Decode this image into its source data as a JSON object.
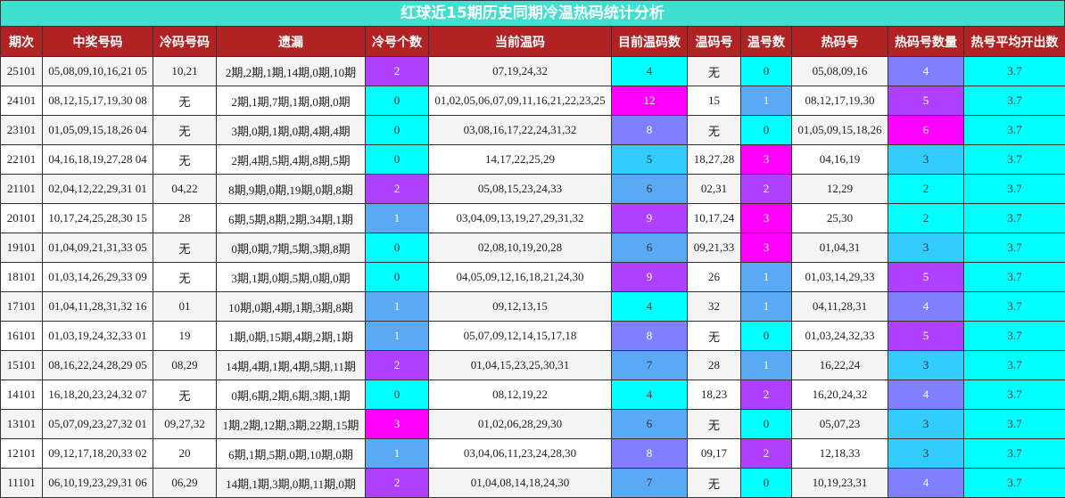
{
  "title": "红球近15期历史同期冷温热码统计分析",
  "headers": [
    "期次",
    "中奖号码",
    "冷码号码",
    "遗漏",
    "冷号个数",
    "当前温码",
    "目前温码数",
    "温码号",
    "温号数",
    "热码号",
    "热码号数量",
    "热号平均开出数"
  ],
  "colors": {
    "title_bg": "#40e0d0",
    "header_bg": "#b22222",
    "count_cyan": "#00ffff",
    "count_blue": "#5aa9f5",
    "count_lightblue": "#33ccff",
    "count_periwinkle": "#8080ff",
    "count_purple": "#b040ff",
    "count_magenta": "#ff00ff",
    "avg_bg": "#00ffff"
  },
  "rows": [
    {
      "period": "25101",
      "numbers": "05,08,09,10,16,21 05",
      "cold": "10,21",
      "missing": "2期,2期,1期,14期,0期,10期",
      "cold_count": "2",
      "warm_current": "07,19,24,32",
      "warm_current_count": "4",
      "warm": "无",
      "warm_count": "0",
      "hot": "05,08,09,16",
      "hot_count": "4",
      "avg": "3.7"
    },
    {
      "period": "24101",
      "numbers": "08,12,15,17,19,30 08",
      "cold": "无",
      "missing": "2期,1期,7期,1期,0期,0期",
      "cold_count": "0",
      "warm_current": "01,02,05,06,07,09,11,16,21,22,23,25",
      "warm_current_count": "12",
      "warm": "15",
      "warm_count": "1",
      "hot": "08,12,17,19,30",
      "hot_count": "5",
      "avg": "3.7"
    },
    {
      "period": "23101",
      "numbers": "01,05,09,15,18,26 04",
      "cold": "无",
      "missing": "3期,0期,1期,0期,4期,4期",
      "cold_count": "0",
      "warm_current": "03,08,16,17,22,24,31,32",
      "warm_current_count": "8",
      "warm": "无",
      "warm_count": "0",
      "hot": "01,05,09,15,18,26",
      "hot_count": "6",
      "avg": "3.7"
    },
    {
      "period": "22101",
      "numbers": "04,16,18,19,27,28 04",
      "cold": "无",
      "missing": "2期,4期,5期,4期,8期,5期",
      "cold_count": "0",
      "warm_current": "14,17,22,25,29",
      "warm_current_count": "5",
      "warm": "18,27,28",
      "warm_count": "3",
      "hot": "04,16,19",
      "hot_count": "3",
      "avg": "3.7"
    },
    {
      "period": "21101",
      "numbers": "02,04,12,22,29,31 01",
      "cold": "04,22",
      "missing": "8期,9期,0期,19期,0期,8期",
      "cold_count": "2",
      "warm_current": "05,08,15,23,24,33",
      "warm_current_count": "6",
      "warm": "02,31",
      "warm_count": "2",
      "hot": "12,29",
      "hot_count": "2",
      "avg": "3.7"
    },
    {
      "period": "20101",
      "numbers": "10,17,24,25,28,30 15",
      "cold": "28",
      "missing": "6期,5期,8期,2期,34期,1期",
      "cold_count": "1",
      "warm_current": "03,04,09,13,19,27,29,31,32",
      "warm_current_count": "9",
      "warm": "10,17,24",
      "warm_count": "3",
      "hot": "25,30",
      "hot_count": "2",
      "avg": "3.7"
    },
    {
      "period": "19101",
      "numbers": "01,04,09,21,31,33 05",
      "cold": "无",
      "missing": "0期,0期,7期,5期,3期,8期",
      "cold_count": "0",
      "warm_current": "02,08,10,19,20,28",
      "warm_current_count": "6",
      "warm": "09,21,33",
      "warm_count": "3",
      "hot": "01,04,31",
      "hot_count": "3",
      "avg": "3.7"
    },
    {
      "period": "18101",
      "numbers": "01,03,14,26,29,33 09",
      "cold": "无",
      "missing": "3期,1期,0期,5期,0期,0期",
      "cold_count": "0",
      "warm_current": "04,05,09,12,16,18,21,24,30",
      "warm_current_count": "9",
      "warm": "26",
      "warm_count": "1",
      "hot": "01,03,14,29,33",
      "hot_count": "5",
      "avg": "3.7"
    },
    {
      "period": "17101",
      "numbers": "01,04,11,28,31,32 16",
      "cold": "01",
      "missing": "10期,0期,4期,1期,3期,8期",
      "cold_count": "1",
      "warm_current": "09,12,13,15",
      "warm_current_count": "4",
      "warm": "32",
      "warm_count": "1",
      "hot": "04,11,28,31",
      "hot_count": "4",
      "avg": "3.7"
    },
    {
      "period": "16101",
      "numbers": "01,03,19,24,32,33 01",
      "cold": "19",
      "missing": "1期,0期,15期,4期,2期,1期",
      "cold_count": "1",
      "warm_current": "05,07,09,12,14,15,17,18",
      "warm_current_count": "8",
      "warm": "无",
      "warm_count": "0",
      "hot": "01,03,24,32,33",
      "hot_count": "5",
      "avg": "3.7"
    },
    {
      "period": "15101",
      "numbers": "08,16,22,24,28,29 05",
      "cold": "08,29",
      "missing": "14期,4期,1期,4期,5期,11期",
      "cold_count": "2",
      "warm_current": "01,04,15,23,25,30,31",
      "warm_current_count": "7",
      "warm": "28",
      "warm_count": "1",
      "hot": "16,22,24",
      "hot_count": "3",
      "avg": "3.7"
    },
    {
      "period": "14101",
      "numbers": "16,18,20,23,24,32 07",
      "cold": "无",
      "missing": "0期,6期,2期,6期,3期,1期",
      "cold_count": "0",
      "warm_current": "08,12,19,22",
      "warm_current_count": "4",
      "warm": "18,23",
      "warm_count": "2",
      "hot": "16,20,24,32",
      "hot_count": "4",
      "avg": "3.7"
    },
    {
      "period": "13101",
      "numbers": "05,07,09,23,27,32 01",
      "cold": "09,27,32",
      "missing": "1期,2期,12期,3期,22期,15期",
      "cold_count": "3",
      "warm_current": "01,02,06,28,29,30",
      "warm_current_count": "6",
      "warm": "无",
      "warm_count": "0",
      "hot": "05,07,23",
      "hot_count": "3",
      "avg": "3.7"
    },
    {
      "period": "12101",
      "numbers": "09,12,17,18,20,33 02",
      "cold": "20",
      "missing": "6期,1期,5期,0期,10期,0期",
      "cold_count": "1",
      "warm_current": "03,04,06,11,23,24,28,30",
      "warm_current_count": "8",
      "warm": "09,17",
      "warm_count": "2",
      "hot": "12,18,33",
      "hot_count": "3",
      "avg": "3.7"
    },
    {
      "period": "11101",
      "numbers": "06,10,19,23,29,31 06",
      "cold": "06,29",
      "missing": "14期,1期,3期,0期,11期,0期",
      "cold_count": "2",
      "warm_current": "01,04,08,14,18,24,30",
      "warm_current_count": "7",
      "warm": "无",
      "warm_count": "0",
      "hot": "10,19,23,31",
      "hot_count": "4",
      "avg": "3.7"
    }
  ]
}
